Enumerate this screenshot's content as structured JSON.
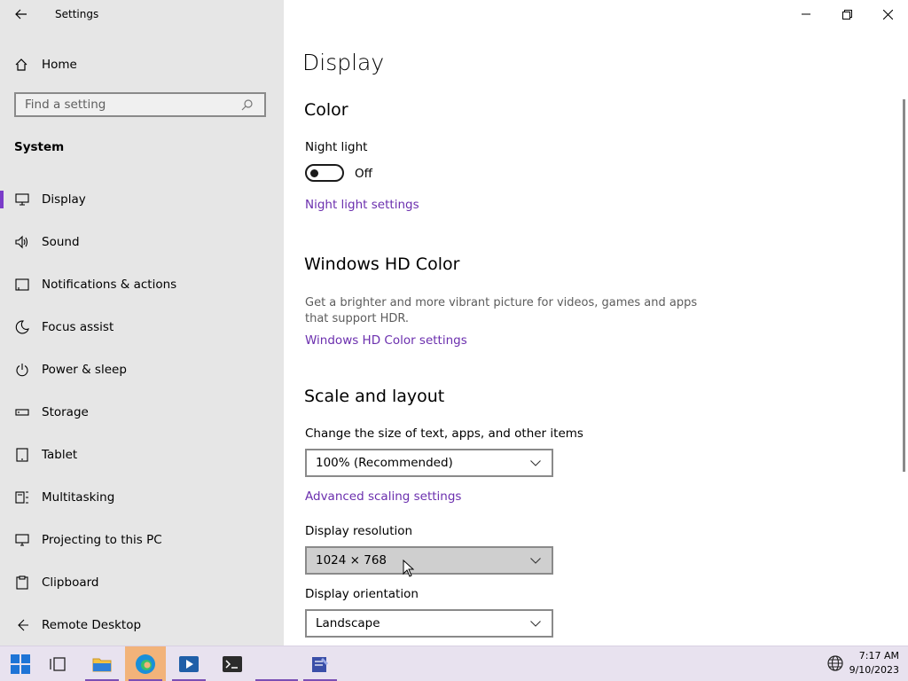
{
  "window": {
    "title": "Settings"
  },
  "sidebar": {
    "home_label": "Home",
    "search_placeholder": "Find a setting",
    "section_label": "System",
    "items": [
      {
        "label": "Display",
        "icon": "monitor-icon",
        "active": true
      },
      {
        "label": "Sound",
        "icon": "speaker-icon"
      },
      {
        "label": "Notifications & actions",
        "icon": "notification-icon"
      },
      {
        "label": "Focus assist",
        "icon": "moon-icon"
      },
      {
        "label": "Power & sleep",
        "icon": "power-icon"
      },
      {
        "label": "Storage",
        "icon": "storage-icon"
      },
      {
        "label": "Tablet",
        "icon": "tablet-icon"
      },
      {
        "label": "Multitasking",
        "icon": "multitasking-icon"
      },
      {
        "label": "Projecting to this PC",
        "icon": "projector-icon"
      },
      {
        "label": "Clipboard",
        "icon": "clipboard-icon"
      },
      {
        "label": "Remote Desktop",
        "icon": "remote-desktop-icon"
      }
    ]
  },
  "main": {
    "page_title": "Display",
    "color": {
      "heading": "Color",
      "night_light_label": "Night light",
      "night_light_state": "Off",
      "night_light_link": "Night light settings"
    },
    "hdr": {
      "heading": "Windows HD Color",
      "description": "Get a brighter and more vibrant picture for videos, games and apps that support HDR.",
      "link": "Windows HD Color settings"
    },
    "scale": {
      "heading": "Scale and layout",
      "size_label": "Change the size of text, apps, and other items",
      "size_value": "100% (Recommended)",
      "advanced_link": "Advanced scaling settings",
      "resolution_label": "Display resolution",
      "resolution_value": "1024 × 768",
      "orientation_label": "Display orientation",
      "orientation_value": "Landscape"
    }
  },
  "taskbar": {
    "time": "7:17 AM",
    "date": "9/10/2023"
  },
  "colors": {
    "accent_link": "#6b2fae",
    "active_indicator": "#7a3cc9",
    "sidebar_bg": "#e6e6e6",
    "taskbar_bg": "#e8e2ef"
  }
}
